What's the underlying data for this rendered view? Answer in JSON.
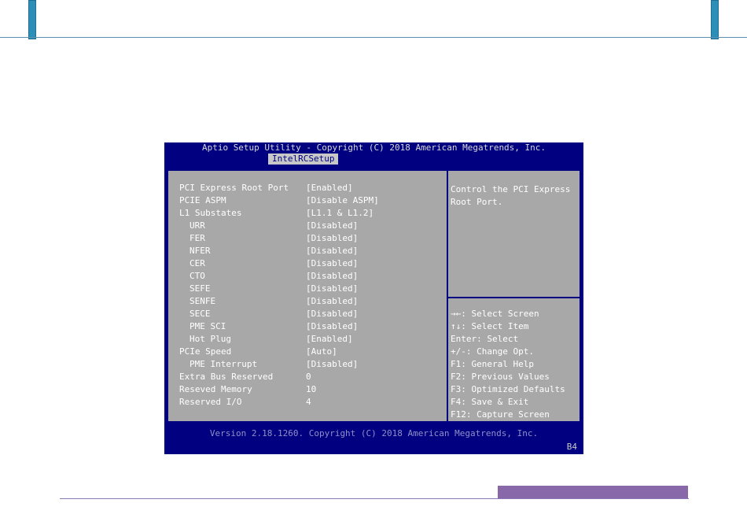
{
  "bios": {
    "title": "Aptio Setup Utility - Copyright (C) 2018 American Megatrends, Inc.",
    "tab": "IntelRCSetup",
    "settings": [
      {
        "name": "PCI Express Root Port",
        "value": "[Enabled]",
        "indent": false
      },
      {
        "name": "PCIE ASPM",
        "value": "[Disable ASPM]",
        "indent": false
      },
      {
        "name": "L1 Substates",
        "value": "[L1.1 & L1.2]",
        "indent": false
      },
      {
        "name": "URR",
        "value": "[Disabled]",
        "indent": true
      },
      {
        "name": "FER",
        "value": "[Disabled]",
        "indent": true
      },
      {
        "name": "NFER",
        "value": "[Disabled]",
        "indent": true
      },
      {
        "name": "CER",
        "value": "[Disabled]",
        "indent": true
      },
      {
        "name": "CTO",
        "value": "[Disabled]",
        "indent": true
      },
      {
        "name": "SEFE",
        "value": "[Disabled]",
        "indent": true
      },
      {
        "name": "SENFE",
        "value": "[Disabled]",
        "indent": true
      },
      {
        "name": "SECE",
        "value": "[Disabled]",
        "indent": true
      },
      {
        "name": "PME SCI",
        "value": "[Disabled]",
        "indent": true
      },
      {
        "name": "Hot Plug",
        "value": "[Enabled]",
        "indent": true
      },
      {
        "name": "PCIe Speed",
        "value": "[Auto]",
        "indent": false
      },
      {
        "name": "PME Interrupt",
        "value": "[Disabled]",
        "indent": true
      },
      {
        "name": "Extra Bus Reserved",
        "value": "0",
        "indent": false
      },
      {
        "name": "Reseved Memory",
        "value": "10",
        "indent": false
      },
      {
        "name": "Reserved I/O",
        "value": "4",
        "indent": false
      }
    ],
    "help": [
      "Control the PCI Express",
      "Root Port."
    ],
    "keys": [
      "→←: Select Screen",
      "↑↓: Select Item",
      "Enter: Select",
      "+/-: Change Opt.",
      "F1: General Help",
      "F2: Previous Values",
      "F3: Optimized Defaults",
      "F4: Save & Exit",
      "F12: Capture Screen"
    ],
    "footer": "Version 2.18.1260. Copyright (C) 2018 American Megatrends, Inc.",
    "code": "B4"
  },
  "colors": {
    "bios_blue": "#000080",
    "panel_gray": "#a8a8a8",
    "accent_teal": "#2d8fb8",
    "accent_purple": "#8868a8"
  }
}
